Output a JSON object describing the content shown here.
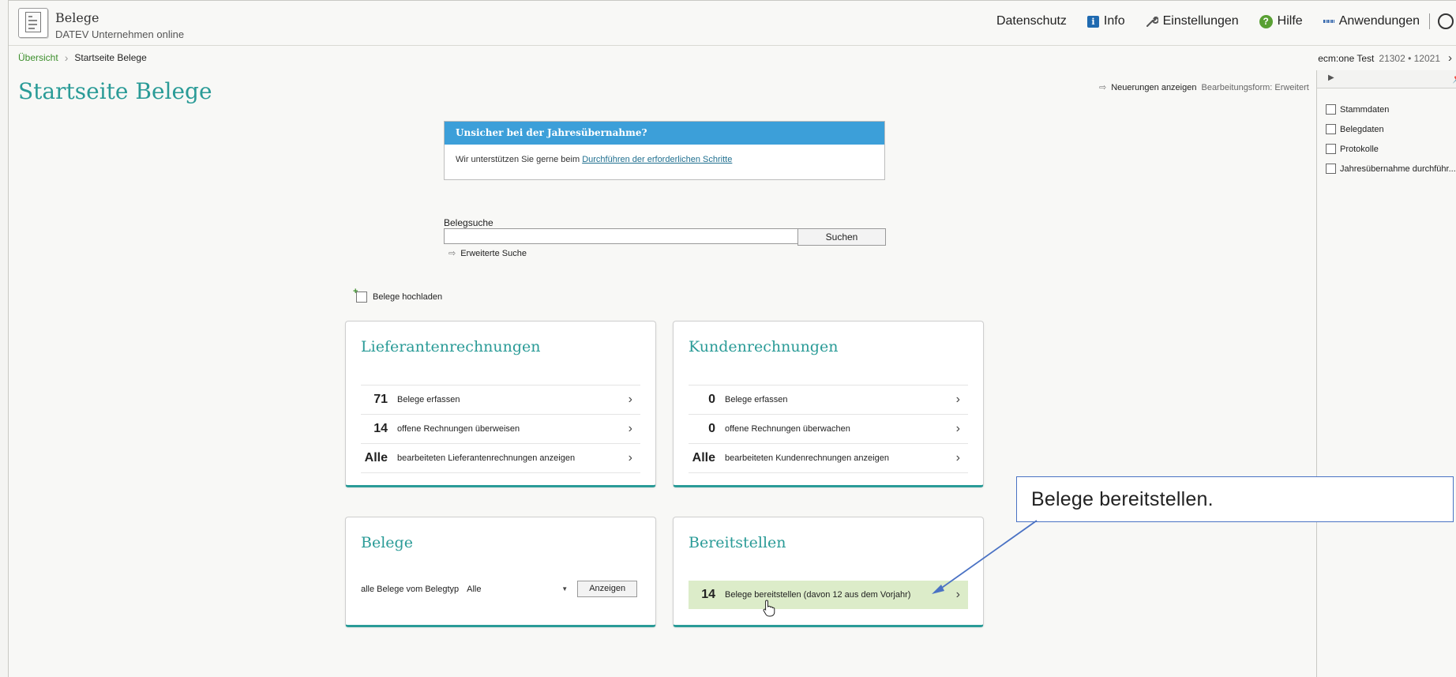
{
  "app": {
    "title": "Belege",
    "subtitle": "DATEV Unternehmen online"
  },
  "topnav": {
    "datenschutz": "Datenschutz",
    "info": "Info",
    "einstellungen": "Einstellungen",
    "hilfe": "Hilfe",
    "anwendungen": "Anwendungen"
  },
  "breadcrumb": {
    "home": "Übersicht",
    "current": "Startseite Belege"
  },
  "context": {
    "name": "ecm:one Test",
    "numbers": "21302 • 12021"
  },
  "page": {
    "title": "Startseite Belege"
  },
  "news": {
    "link": "Neuerungen anzeigen",
    "mode": "Bearbeitungsform: Erweitert"
  },
  "infobox": {
    "title": "Unsicher bei der Jahresübernahme?",
    "text": "Wir unterstützen Sie gerne beim ",
    "link": "Durchführen der erforderlichen Schritte"
  },
  "search": {
    "label": "Belegsuche",
    "value": "",
    "button": "Suchen",
    "advanced": "Erweiterte Suche"
  },
  "upload": {
    "label": "Belege hochladen"
  },
  "cards": {
    "lieferanten": {
      "title": "Lieferantenrechnungen",
      "rows": [
        {
          "num": "71",
          "text": "Belege erfassen"
        },
        {
          "num": "14",
          "text": "offene Rechnungen überweisen"
        },
        {
          "num": "Alle",
          "text": "bearbeiteten Lieferantenrechnungen anzeigen"
        }
      ]
    },
    "kunden": {
      "title": "Kundenrechnungen",
      "rows": [
        {
          "num": "0",
          "text": "Belege erfassen"
        },
        {
          "num": "0",
          "text": "offene Rechnungen überwachen"
        },
        {
          "num": "Alle",
          "text": "bearbeiteten Kundenrechnungen anzeigen"
        }
      ]
    },
    "belege": {
      "title": "Belege",
      "type_label": "alle Belege vom Belegtyp",
      "type_value": "Alle",
      "button": "Anzeigen"
    },
    "bereitstellen": {
      "title": "Bereitstellen",
      "row": {
        "num": "14",
        "text": "Belege bereitstellen (davon 12 aus dem Vorjahr)"
      }
    }
  },
  "sidepanel": {
    "items": [
      "Stammdaten",
      "Belegdaten",
      "Protokolle",
      "Jahresübernahme durchführ..."
    ]
  },
  "callout": {
    "text": "Belege bereitstellen."
  },
  "colors": {
    "accent": "#2a9b97",
    "link_green": "#3d8f2d",
    "info_blue": "#3c9fd9",
    "highlight": "#dcecc9",
    "callout_border": "#4a72c4"
  }
}
